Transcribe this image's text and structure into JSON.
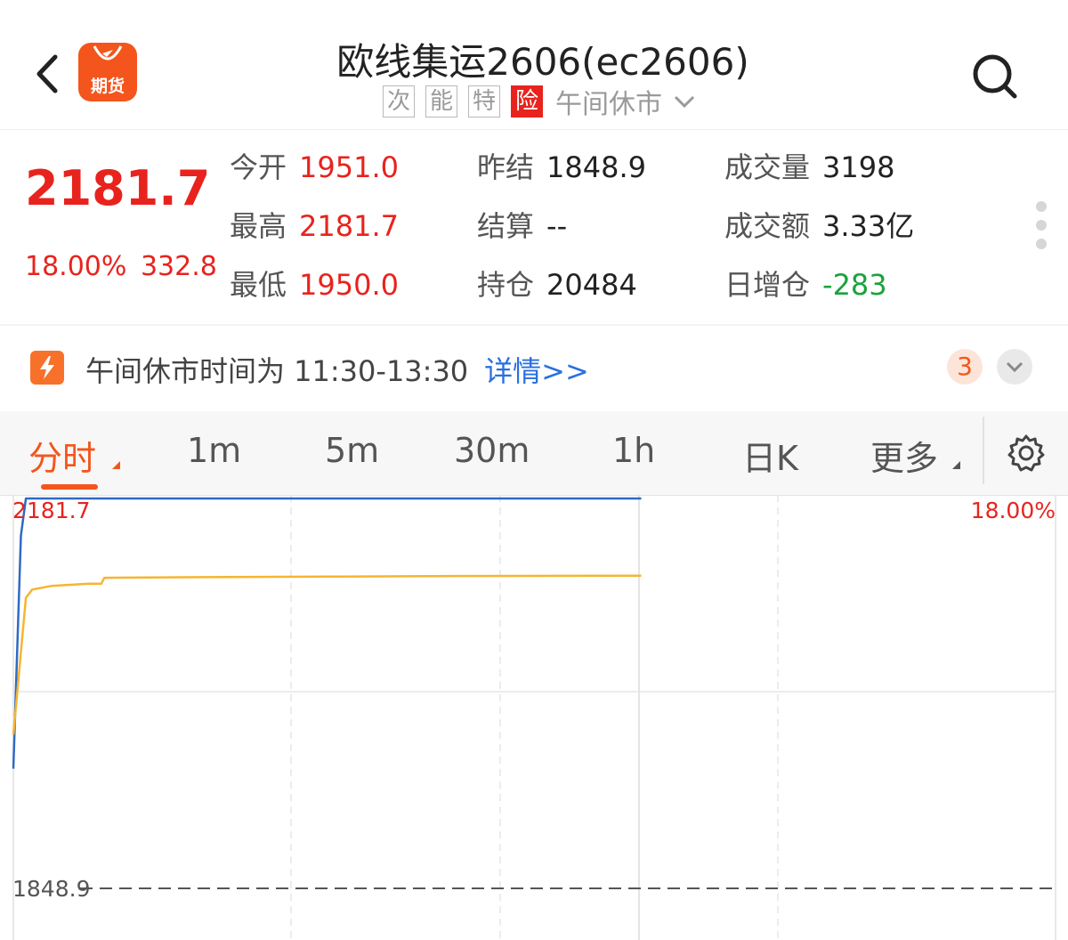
{
  "header": {
    "logo_label": "期货",
    "title": "欧线集运2606(ec2606)",
    "tags": [
      "次",
      "能",
      "特",
      "险"
    ],
    "status": "午间休市"
  },
  "quote": {
    "last_price": "2181.7",
    "change_pct": "18.00%",
    "change_value": "332.8",
    "fields": {
      "open": {
        "label": "今开",
        "value": "1951.0"
      },
      "high": {
        "label": "最高",
        "value": "2181.7"
      },
      "low": {
        "label": "最低",
        "value": "1950.0"
      },
      "prev_settle": {
        "label": "昨结",
        "value": "1848.9"
      },
      "settle": {
        "label": "结算",
        "value": "--"
      },
      "open_interest": {
        "label": "持仓",
        "value": "20484"
      },
      "volume": {
        "label": "成交量",
        "value": "3198"
      },
      "turnover": {
        "label": "成交额",
        "value": "3.33亿"
      },
      "oi_change": {
        "label": "日增仓",
        "value": "-283"
      }
    }
  },
  "notice": {
    "text": "午间休市时间为 11:30-13:30",
    "link": "详情>>",
    "badge": "3"
  },
  "tabs": {
    "items": [
      "分时",
      "1m",
      "5m",
      "30m",
      "1h",
      "日K",
      "更多"
    ],
    "active": "分时"
  },
  "colors": {
    "accent": "#f4551c",
    "up": "#e8231e",
    "down": "#1aa33c",
    "link": "#2a6fe0",
    "price_line": "#2f6ac4",
    "avg_line": "#f5b531"
  },
  "chart_data": {
    "type": "line",
    "y_max_label": "2181.7",
    "y_base_label": "1848.9",
    "pct_max_label": "18.00%",
    "ylim": [
      1848.9,
      2181.7
    ],
    "session_progress": 0.5,
    "series": [
      {
        "key": "price",
        "color": "#2f6ac4",
        "points": [
          [
            0.0,
            1951.0
          ],
          [
            0.012,
            2150.0
          ],
          [
            0.02,
            2181.7
          ],
          [
            1.0,
            2181.7
          ]
        ]
      },
      {
        "key": "average",
        "color": "#f5b531",
        "points": [
          [
            0.0,
            1980.0
          ],
          [
            0.02,
            2097.0
          ],
          [
            0.03,
            2104.0
          ],
          [
            0.06,
            2107.0
          ],
          [
            0.12,
            2109.0
          ],
          [
            0.14,
            2109.0
          ],
          [
            0.145,
            2114.0
          ],
          [
            0.3,
            2114.5
          ],
          [
            0.5,
            2115.0
          ],
          [
            0.7,
            2115.5
          ],
          [
            1.0,
            2115.8
          ]
        ]
      }
    ]
  }
}
